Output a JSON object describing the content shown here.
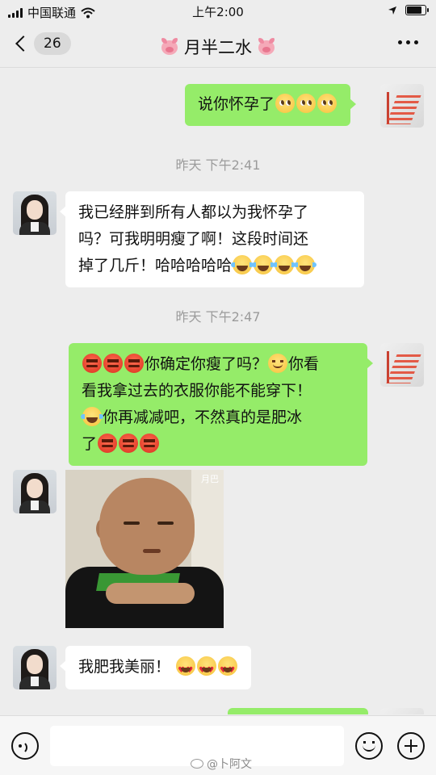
{
  "status_bar": {
    "carrier": "中国联通",
    "time": "上午2:00",
    "battery_level": 0.85
  },
  "nav": {
    "unread_count": "26",
    "title": "月半二水"
  },
  "messages": {
    "m1": {
      "from": "self",
      "text": "说你怀孕了"
    },
    "ts1": "昨天 下午2:41",
    "m2": {
      "from": "other",
      "line1": "我已经胖到所有人都以为我怀孕了",
      "line2": "吗？可我明明瘦了啊！这段时间还",
      "line3": "掉了几斤！哈哈哈哈哈"
    },
    "ts2": "昨天 下午2:47",
    "m3": {
      "from": "self",
      "line1": "你确定你瘦了吗？",
      "line1b": "你看",
      "line2": "看我拿过去的衣服你能不能穿下！",
      "line3": "你再减减吧，不然真的是肥冰",
      "line4": "了"
    },
    "m4": {
      "from": "other",
      "type": "sticker",
      "sticker_tag": "月巴"
    },
    "m5": {
      "from": "other",
      "text": "我肥我美丽！"
    }
  },
  "watermark": "@卜阿文",
  "icons": {
    "back": "chevron-left-icon",
    "more": "more-dots-icon",
    "voice": "voice-icon",
    "emoji": "emoji-icon",
    "plus": "plus-icon"
  },
  "colors": {
    "background": "#ededed",
    "outgoing_bubble": "#95ec69",
    "incoming_bubble": "#ffffff",
    "timestamp": "#9b9b9b"
  }
}
